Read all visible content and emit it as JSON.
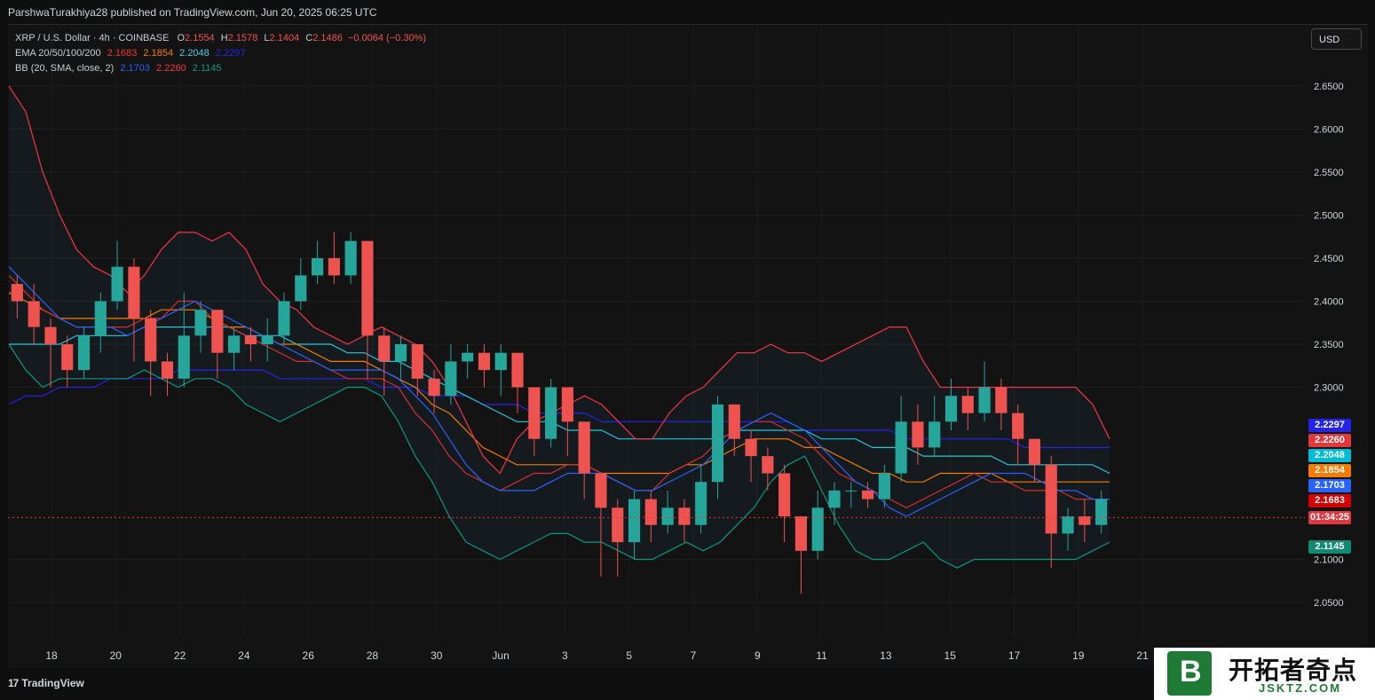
{
  "header": {
    "publisher_line": "ParshwaTurakhiya28 published on TradingView.com, Jun 20, 2025 06:25 UTC"
  },
  "legend": {
    "symbol": "XRP / U.S. Dollar · 4h · COINBASE",
    "o_label": "O",
    "o": "2.1554",
    "h_label": "H",
    "h": "2.1578",
    "l_label": "L",
    "l": "2.1404",
    "c_label": "C",
    "c": "2.1486",
    "change": "−0.0064 (−0.30%)",
    "ema_label": "EMA 20/50/100/200",
    "ema20": "2.1683",
    "ema50": "2.1854",
    "ema100": "2.2048",
    "ema200": "2.2297",
    "bb_label": "BB (20, SMA, close, 2)",
    "bb_mid": "2.1703",
    "bb_upper": "2.2260",
    "bb_lower": "2.1145"
  },
  "currency_button": "USD",
  "price_tags": [
    {
      "text": "2.2297",
      "color": "#2424e8",
      "value": 2.2297
    },
    {
      "text": "2.2260",
      "color": "#e0383f",
      "value": 2.226
    },
    {
      "text": "2.2048",
      "color": "#00bcd4",
      "value": 2.2048
    },
    {
      "text": "2.1854",
      "color": "#f57c00",
      "value": 2.1854
    },
    {
      "text": "2.1703",
      "color": "#2962ff",
      "value": 2.1703
    },
    {
      "text": "2.1683",
      "color": "#d50000",
      "value": 2.1683
    },
    {
      "text": "01:34:25",
      "color": "#e0383f",
      "value": 2.1486
    },
    {
      "text": "2.1145",
      "color": "#128a6f",
      "value": 2.1145
    }
  ],
  "footer": {
    "brand": "TradingView",
    "brand_mark": "17"
  },
  "watermark": {
    "letter": "B",
    "title": "开拓者奇点",
    "sub": "JSKTZ.COM"
  },
  "chart_data": {
    "type": "candlestick",
    "title": "XRP / U.S. Dollar · 4h · COINBASE",
    "ylim": [
      2.0,
      2.7
    ],
    "y_ticks": [
      "2.6500",
      "2.6000",
      "2.5500",
      "2.5000",
      "2.4500",
      "2.4000",
      "2.3500",
      "2.3000",
      "2.0500",
      "2.1000"
    ],
    "y_tick_values": [
      2.65,
      2.6,
      2.55,
      2.5,
      2.45,
      2.4,
      2.35,
      2.3,
      2.05,
      2.1
    ],
    "x_ticks": [
      "18",
      "20",
      "22",
      "24",
      "26",
      "28",
      "30",
      "Jun",
      "3",
      "5",
      "7",
      "9",
      "11",
      "13",
      "15",
      "17",
      "19",
      "21"
    ],
    "last_price": 2.1486,
    "colors": {
      "up": "#26a69a",
      "down": "#ef5350"
    },
    "lines": {
      "bb_upper": [
        2.65,
        2.62,
        2.55,
        2.5,
        2.46,
        2.44,
        2.43,
        2.41,
        2.43,
        2.46,
        2.48,
        2.48,
        2.47,
        2.48,
        2.46,
        2.42,
        2.4,
        2.39,
        2.37,
        2.36,
        2.35,
        2.36,
        2.37,
        2.36,
        2.35,
        2.33,
        2.3,
        2.26,
        2.22,
        2.2,
        2.24,
        2.26,
        2.27,
        2.28,
        2.29,
        2.28,
        2.26,
        2.24,
        2.24,
        2.27,
        2.29,
        2.3,
        2.32,
        2.34,
        2.34,
        2.35,
        2.34,
        2.34,
        2.33,
        2.34,
        2.35,
        2.36,
        2.37,
        2.37,
        2.33,
        2.3,
        2.3,
        2.3,
        2.3,
        2.3,
        2.3,
        2.3,
        2.3,
        2.3,
        2.28,
        2.24
      ],
      "bb_mid": [
        2.44,
        2.42,
        2.4,
        2.38,
        2.37,
        2.37,
        2.37,
        2.36,
        2.37,
        2.38,
        2.39,
        2.4,
        2.39,
        2.38,
        2.37,
        2.36,
        2.35,
        2.34,
        2.33,
        2.32,
        2.32,
        2.32,
        2.32,
        2.31,
        2.29,
        2.27,
        2.24,
        2.21,
        2.19,
        2.18,
        2.18,
        2.18,
        2.19,
        2.2,
        2.2,
        2.2,
        2.19,
        2.18,
        2.18,
        2.19,
        2.2,
        2.21,
        2.23,
        2.25,
        2.26,
        2.27,
        2.26,
        2.25,
        2.23,
        2.21,
        2.19,
        2.18,
        2.16,
        2.15,
        2.16,
        2.17,
        2.18,
        2.19,
        2.2,
        2.2,
        2.2,
        2.19,
        2.18,
        2.18,
        2.17,
        2.17
      ],
      "bb_lower": [
        2.35,
        2.32,
        2.3,
        2.31,
        2.31,
        2.31,
        2.31,
        2.31,
        2.32,
        2.31,
        2.3,
        2.31,
        2.31,
        2.3,
        2.28,
        2.27,
        2.26,
        2.27,
        2.28,
        2.29,
        2.3,
        2.3,
        2.29,
        2.26,
        2.22,
        2.19,
        2.15,
        2.12,
        2.11,
        2.1,
        2.11,
        2.12,
        2.13,
        2.13,
        2.12,
        2.12,
        2.11,
        2.1,
        2.1,
        2.11,
        2.12,
        2.11,
        2.12,
        2.14,
        2.16,
        2.19,
        2.21,
        2.22,
        2.18,
        2.14,
        2.11,
        2.1,
        2.1,
        2.11,
        2.12,
        2.1,
        2.09,
        2.1,
        2.1,
        2.1,
        2.1,
        2.1,
        2.1,
        2.1,
        2.11,
        2.12
      ],
      "ema20": [
        2.43,
        2.41,
        2.39,
        2.38,
        2.37,
        2.37,
        2.37,
        2.37,
        2.38,
        2.38,
        2.4,
        2.4,
        2.38,
        2.37,
        2.36,
        2.35,
        2.34,
        2.33,
        2.33,
        2.32,
        2.31,
        2.31,
        2.31,
        2.3,
        2.27,
        2.25,
        2.22,
        2.2,
        2.19,
        2.18,
        2.19,
        2.2,
        2.2,
        2.21,
        2.21,
        2.2,
        2.19,
        2.18,
        2.18,
        2.2,
        2.21,
        2.22,
        2.24,
        2.25,
        2.26,
        2.26,
        2.25,
        2.24,
        2.22,
        2.2,
        2.19,
        2.18,
        2.17,
        2.16,
        2.17,
        2.18,
        2.19,
        2.2,
        2.19,
        2.19,
        2.18,
        2.18,
        2.18,
        2.17,
        2.17,
        2.17
      ],
      "ema50": [
        2.41,
        2.4,
        2.39,
        2.38,
        2.38,
        2.38,
        2.38,
        2.38,
        2.38,
        2.39,
        2.39,
        2.39,
        2.38,
        2.37,
        2.37,
        2.36,
        2.35,
        2.35,
        2.34,
        2.33,
        2.33,
        2.33,
        2.32,
        2.31,
        2.3,
        2.28,
        2.27,
        2.25,
        2.23,
        2.22,
        2.21,
        2.21,
        2.21,
        2.21,
        2.21,
        2.2,
        2.2,
        2.2,
        2.2,
        2.2,
        2.21,
        2.21,
        2.22,
        2.23,
        2.24,
        2.24,
        2.24,
        2.23,
        2.23,
        2.22,
        2.21,
        2.2,
        2.2,
        2.19,
        2.19,
        2.2,
        2.2,
        2.2,
        2.2,
        2.19,
        2.19,
        2.19,
        2.19,
        2.19,
        2.19,
        2.19
      ],
      "ema100": [
        2.35,
        2.35,
        2.35,
        2.35,
        2.36,
        2.36,
        2.36,
        2.36,
        2.37,
        2.37,
        2.37,
        2.37,
        2.37,
        2.37,
        2.36,
        2.36,
        2.36,
        2.35,
        2.35,
        2.35,
        2.34,
        2.34,
        2.33,
        2.33,
        2.32,
        2.31,
        2.3,
        2.29,
        2.28,
        2.27,
        2.26,
        2.26,
        2.26,
        2.25,
        2.25,
        2.25,
        2.24,
        2.24,
        2.24,
        2.24,
        2.24,
        2.24,
        2.24,
        2.25,
        2.25,
        2.25,
        2.25,
        2.25,
        2.24,
        2.24,
        2.24,
        2.23,
        2.23,
        2.23,
        2.22,
        2.22,
        2.22,
        2.22,
        2.22,
        2.21,
        2.21,
        2.21,
        2.21,
        2.21,
        2.21,
        2.2
      ],
      "ema200": [
        2.28,
        2.29,
        2.29,
        2.3,
        2.3,
        2.3,
        2.31,
        2.31,
        2.31,
        2.31,
        2.32,
        2.32,
        2.32,
        2.32,
        2.32,
        2.32,
        2.31,
        2.31,
        2.31,
        2.31,
        2.31,
        2.31,
        2.3,
        2.3,
        2.3,
        2.29,
        2.29,
        2.29,
        2.28,
        2.28,
        2.28,
        2.27,
        2.27,
        2.27,
        2.27,
        2.26,
        2.26,
        2.26,
        2.26,
        2.26,
        2.26,
        2.26,
        2.26,
        2.26,
        2.26,
        2.26,
        2.26,
        2.25,
        2.25,
        2.25,
        2.25,
        2.25,
        2.25,
        2.24,
        2.24,
        2.24,
        2.24,
        2.24,
        2.24,
        2.24,
        2.23,
        2.23,
        2.23,
        2.23,
        2.23,
        2.23
      ]
    },
    "candles": [
      [
        2.42,
        2.4,
        2.43,
        2.38
      ],
      [
        2.4,
        2.37,
        2.42,
        2.35
      ],
      [
        2.37,
        2.35,
        2.38,
        2.3
      ],
      [
        2.35,
        2.32,
        2.36,
        2.3
      ],
      [
        2.32,
        2.36,
        2.37,
        2.31
      ],
      [
        2.36,
        2.4,
        2.41,
        2.34
      ],
      [
        2.4,
        2.44,
        2.47,
        2.39
      ],
      [
        2.44,
        2.38,
        2.45,
        2.33
      ],
      [
        2.38,
        2.33,
        2.39,
        2.29
      ],
      [
        2.33,
        2.31,
        2.34,
        2.29
      ],
      [
        2.31,
        2.36,
        2.41,
        2.3
      ],
      [
        2.36,
        2.39,
        2.4,
        2.34
      ],
      [
        2.39,
        2.34,
        2.39,
        2.31
      ],
      [
        2.34,
        2.36,
        2.37,
        2.32
      ],
      [
        2.36,
        2.35,
        2.37,
        2.33
      ],
      [
        2.35,
        2.36,
        2.38,
        2.33
      ],
      [
        2.36,
        2.4,
        2.41,
        2.35
      ],
      [
        2.4,
        2.43,
        2.45,
        2.39
      ],
      [
        2.43,
        2.45,
        2.47,
        2.42
      ],
      [
        2.45,
        2.43,
        2.48,
        2.42
      ],
      [
        2.43,
        2.47,
        2.48,
        2.42
      ],
      [
        2.47,
        2.36,
        2.47,
        2.31
      ],
      [
        2.36,
        2.33,
        2.37,
        2.29
      ],
      [
        2.33,
        2.35,
        2.36,
        2.31
      ],
      [
        2.35,
        2.31,
        2.35,
        2.29
      ],
      [
        2.31,
        2.29,
        2.32,
        2.27
      ],
      [
        2.29,
        2.33,
        2.35,
        2.28
      ],
      [
        2.33,
        2.34,
        2.35,
        2.31
      ],
      [
        2.34,
        2.32,
        2.35,
        2.3
      ],
      [
        2.32,
        2.34,
        2.35,
        2.29
      ],
      [
        2.34,
        2.3,
        2.34,
        2.27
      ],
      [
        2.3,
        2.24,
        2.3,
        2.22
      ],
      [
        2.24,
        2.3,
        2.31,
        2.23
      ],
      [
        2.3,
        2.26,
        2.3,
        2.22
      ],
      [
        2.26,
        2.2,
        2.26,
        2.17
      ],
      [
        2.2,
        2.16,
        2.2,
        2.08
      ],
      [
        2.16,
        2.12,
        2.17,
        2.08
      ],
      [
        2.12,
        2.17,
        2.18,
        2.1
      ],
      [
        2.17,
        2.14,
        2.18,
        2.12
      ],
      [
        2.14,
        2.16,
        2.18,
        2.13
      ],
      [
        2.16,
        2.14,
        2.17,
        2.12
      ],
      [
        2.14,
        2.19,
        2.21,
        2.13
      ],
      [
        2.19,
        2.28,
        2.29,
        2.17
      ],
      [
        2.28,
        2.24,
        2.28,
        2.22
      ],
      [
        2.24,
        2.22,
        2.25,
        2.19
      ],
      [
        2.22,
        2.2,
        2.23,
        2.18
      ],
      [
        2.2,
        2.15,
        2.21,
        2.12
      ],
      [
        2.15,
        2.11,
        2.15,
        2.06
      ],
      [
        2.11,
        2.16,
        2.18,
        2.1
      ],
      [
        2.16,
        2.18,
        2.19,
        2.14
      ],
      [
        2.18,
        2.18,
        2.19,
        2.16
      ],
      [
        2.18,
        2.17,
        2.19,
        2.16
      ],
      [
        2.17,
        2.2,
        2.21,
        2.16
      ],
      [
        2.2,
        2.26,
        2.29,
        2.19
      ],
      [
        2.26,
        2.23,
        2.28,
        2.21
      ],
      [
        2.23,
        2.26,
        2.29,
        2.22
      ],
      [
        2.26,
        2.29,
        2.31,
        2.25
      ],
      [
        2.29,
        2.27,
        2.3,
        2.25
      ],
      [
        2.27,
        2.3,
        2.33,
        2.26
      ],
      [
        2.3,
        2.27,
        2.31,
        2.25
      ],
      [
        2.27,
        2.24,
        2.28,
        2.21
      ],
      [
        2.24,
        2.21,
        2.24,
        2.19
      ],
      [
        2.21,
        2.13,
        2.22,
        2.09
      ],
      [
        2.13,
        2.15,
        2.16,
        2.11
      ],
      [
        2.15,
        2.14,
        2.17,
        2.12
      ],
      [
        2.14,
        2.17,
        2.18,
        2.13
      ]
    ]
  }
}
